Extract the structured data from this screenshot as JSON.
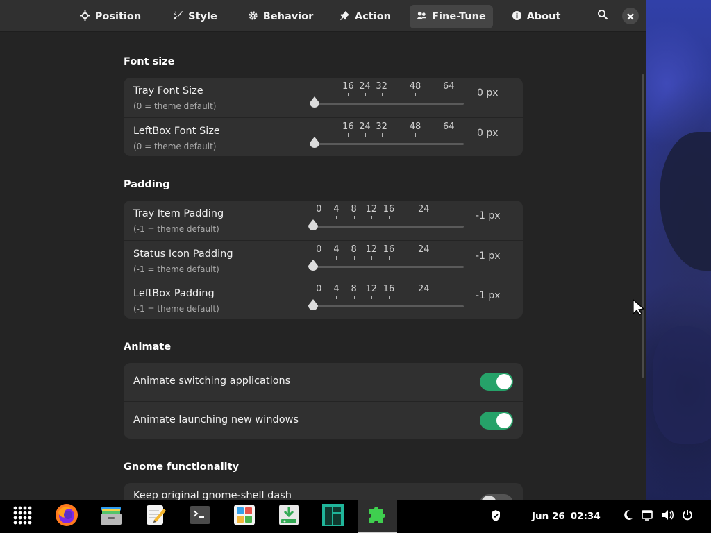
{
  "tabs": [
    {
      "label": "Position",
      "icon": "crosshair-icon"
    },
    {
      "label": "Style",
      "icon": "brush-icon"
    },
    {
      "label": "Behavior",
      "icon": "gear-icon"
    },
    {
      "label": "Action",
      "icon": "pin-icon"
    },
    {
      "label": "Fine-Tune",
      "icon": "tune-icon",
      "active": true
    },
    {
      "label": "About",
      "icon": "info-icon"
    }
  ],
  "header_buttons": {
    "search": "search-icon",
    "close": "close-icon"
  },
  "sections": {
    "font_size": {
      "title": "Font size",
      "rows": [
        {
          "title": "Tray Font Size",
          "subtitle": "(0 = theme default)",
          "value": "0 px",
          "marks": [
            "16",
            "24",
            "32",
            "48",
            "64"
          ],
          "current": 0
        },
        {
          "title": "LeftBox Font Size",
          "subtitle": "(0 = theme default)",
          "value": "0 px",
          "marks": [
            "16",
            "24",
            "32",
            "48",
            "64"
          ],
          "current": 0
        }
      ]
    },
    "padding": {
      "title": "Padding",
      "rows": [
        {
          "title": "Tray Item Padding",
          "subtitle": "(-1 = theme default)",
          "value": "-1 px",
          "marks": [
            "0",
            "4",
            "8",
            "12",
            "16",
            "24"
          ],
          "current": -1
        },
        {
          "title": "Status Icon Padding",
          "subtitle": "(-1 = theme default)",
          "value": "-1 px",
          "marks": [
            "0",
            "4",
            "8",
            "12",
            "16",
            "24"
          ],
          "current": -1
        },
        {
          "title": "LeftBox Padding",
          "subtitle": "(-1 = theme default)",
          "value": "-1 px",
          "marks": [
            "0",
            "4",
            "8",
            "12",
            "16",
            "24"
          ],
          "current": -1
        }
      ]
    },
    "animate": {
      "title": "Animate",
      "rows": [
        {
          "title": "Animate switching applications",
          "enabled": true
        },
        {
          "title": "Animate launching new windows",
          "enabled": true
        }
      ]
    },
    "gnome": {
      "title": "Gnome functionality",
      "rows": [
        {
          "title": "Keep original gnome-shell dash",
          "enabled": false
        }
      ]
    }
  },
  "taskbar": {
    "apps": [
      "app-grid-icon",
      "firefox-icon",
      "files-icon",
      "text-editor-icon",
      "terminal-icon",
      "software-icon",
      "installer-icon",
      "manjaro-icon",
      "extensions-icon"
    ],
    "active_app": "extensions-icon",
    "date": "Jun 26",
    "time": "02:34",
    "tray": [
      "shield-icon",
      "night-mode-icon",
      "display-icon",
      "volume-icon",
      "power-icon"
    ]
  },
  "colors": {
    "window_bg": "#242424",
    "headerbar_bg": "#303030",
    "card_bg": "#303030",
    "toggle_on": "#26a269",
    "accent_active_tab": "#454545"
  }
}
